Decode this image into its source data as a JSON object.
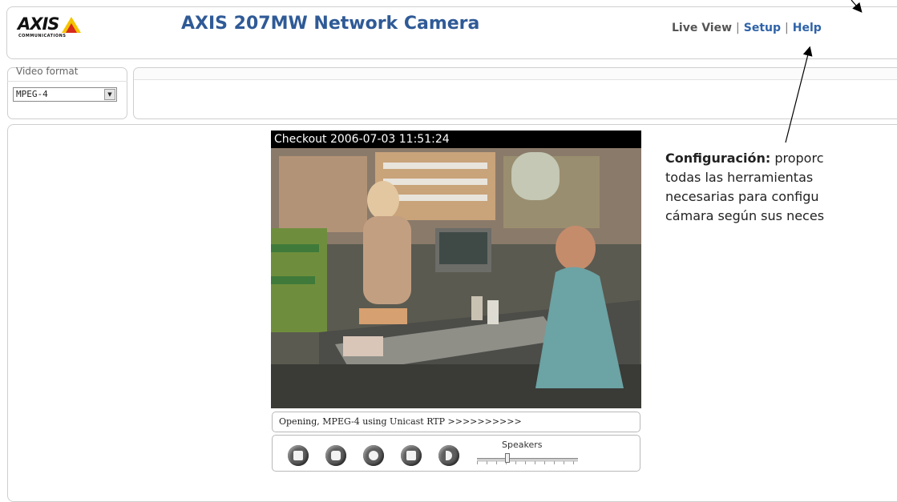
{
  "header": {
    "logo_text": "AXIS",
    "logo_subtext": "COMMUNICATIONS",
    "title": "AXIS 207MW Network Camera",
    "nav": {
      "live_view": "Live View",
      "separator": "|",
      "setup": "Setup",
      "help": "Help"
    }
  },
  "video_format": {
    "label": "Video format",
    "selected": "MPEG-4"
  },
  "video": {
    "overlay_text": "Checkout 2006-07-03 11:51:24",
    "status": "Opening, MPEG-4 using Unicast RTP >>>>>>>>>>"
  },
  "controls": {
    "buttons": [
      "stop-icon",
      "snapshot-icon",
      "record-icon",
      "fullscreen-icon",
      "speaker-icon"
    ],
    "speakers_label": "Speakers",
    "speaker_volume": 0.3
  },
  "annotation": {
    "term": "Configuración:",
    "line1": " proporc",
    "line2": "todas las herramientas",
    "line3": "necesarias para configu",
    "line4": "cámara según sus neces"
  },
  "colors": {
    "title": "#2f5a96",
    "link": "#2f63a8",
    "logo_accent": "#f5c400",
    "logo_red": "#d62a1e"
  }
}
